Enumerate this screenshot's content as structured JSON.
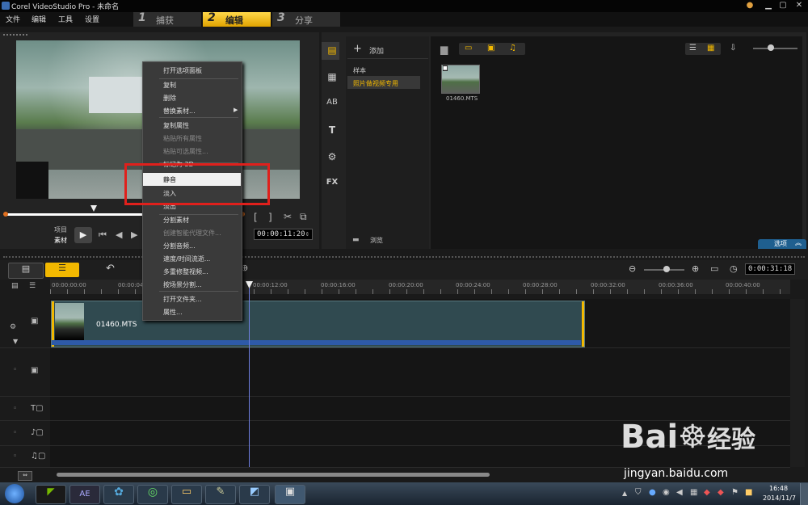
{
  "window": {
    "title": "Corel VideoStudio Pro - 未命名"
  },
  "menu": [
    "文件",
    "编辑",
    "工具",
    "设置"
  ],
  "steps": [
    {
      "num": "1",
      "label": "捕获"
    },
    {
      "num": "2",
      "label": "编辑"
    },
    {
      "num": "3",
      "label": "分享"
    }
  ],
  "player": {
    "project_label": "项目",
    "clip_label": "素材",
    "timecode": "00:00:11:20"
  },
  "library": {
    "add_label": "添加",
    "folders": [
      "样本",
      "照片做视频专用"
    ],
    "browse_label": "浏览",
    "clip_name": "01460.MTS",
    "options_label": "选项"
  },
  "timeline": {
    "total_time": "0:00:31:18",
    "ruler": [
      "00:00:00:00",
      "00:00:04:",
      "00:00:12:00",
      "00:00:16:00",
      "00:00:20:00",
      "00:00:24:00",
      "00:00:28:00",
      "00:00:32:00",
      "00:00:36:00",
      "00:00:40:00"
    ],
    "clip_label": "01460.MTS"
  },
  "context_menu": {
    "items": [
      {
        "label": "打开选项面板",
        "disabled": false
      },
      {
        "label": "复制",
        "disabled": false
      },
      {
        "label": "删除",
        "disabled": false
      },
      {
        "label": "替换素材...",
        "disabled": false
      },
      {
        "label": "复制属性",
        "disabled": false
      },
      {
        "label": "粘贴所有属性",
        "disabled": true
      },
      {
        "label": "粘贴可选属性...",
        "disabled": true
      },
      {
        "label": "标记为 3D",
        "disabled": false
      },
      {
        "label": "静音",
        "disabled": false
      },
      {
        "label": "淡入",
        "disabled": false
      },
      {
        "label": "淡出",
        "disabled": false
      },
      {
        "label": "分割素材",
        "disabled": false
      },
      {
        "label": "创建智能代理文件...",
        "disabled": true
      },
      {
        "label": "分割音频...",
        "disabled": false
      },
      {
        "label": "速度/时间流逝...",
        "disabled": false
      },
      {
        "label": "多重修整视频...",
        "disabled": false
      },
      {
        "label": "按场景分割...",
        "disabled": false
      },
      {
        "label": "打开文件夹...",
        "disabled": false
      },
      {
        "label": "属性...",
        "disabled": false
      }
    ]
  },
  "taskbar": {
    "time": "16:48",
    "date": "2014/11/7"
  },
  "watermark": {
    "brand": "Bai",
    "brand2": "经验",
    "url": "jingyan.baidu.com"
  },
  "colors": {
    "accent": "#f2b800",
    "highlight_box": "#e0201c",
    "options_bar": "#1f5f8f"
  }
}
